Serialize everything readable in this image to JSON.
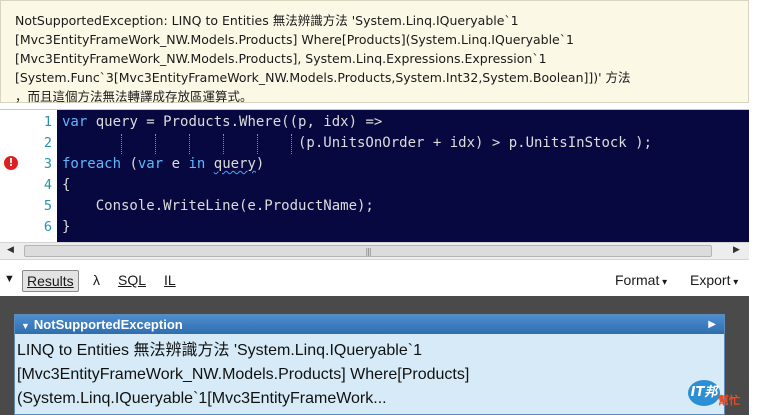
{
  "error_banner": {
    "lines": [
      "NotSupportedException: LINQ to Entities 無法辨識方法 'System.Linq.IQueryable`1",
      "[Mvc3EntityFrameWork_NW.Models.Products] Where[Products](System.Linq.IQueryable`1",
      "[Mvc3EntityFrameWork_NW.Models.Products], System.Linq.Expressions.Expression`1",
      "[System.Func`3[Mvc3EntityFrameWork_NW.Models.Products,System.Int32,System.Boolean]])' 方法",
      "，而且這個方法無法轉譯成存放區運算式。"
    ]
  },
  "editor": {
    "line_numbers": [
      "1",
      "2",
      "3",
      "4",
      "5",
      "6"
    ],
    "code": {
      "l1_kw": "var",
      "l1_rest": " query = Products.Where((p, idx) =>",
      "l2": "                            (p.UnitsOnOrder + idx) > p.UnitsInStock );",
      "l3_kw1": "foreach",
      "l3_mid": " (",
      "l3_kw2": "var",
      "l3_e": " e ",
      "l3_kw3": "in",
      "l3_sp": " ",
      "l3_query": "query",
      "l3_end": ")",
      "l4": "{",
      "l5": "    Console.WriteLine(e.ProductName);",
      "l6": "}"
    },
    "error_marker_icon": "error-circle-icon",
    "scroll_grip": "|||"
  },
  "toolbar": {
    "results": "Results",
    "lambda": "λ",
    "sql": "SQL",
    "il": "IL",
    "format": "Format",
    "export": "Export"
  },
  "results": {
    "header": "NotSupportedException",
    "body_lines": [
      "LINQ to Entities 無法辨識方法 'System.Linq.IQueryable`1",
      "[Mvc3EntityFrameWork_NW.Models.Products] Where[Products]",
      "(System.Linq.IQueryable`1[Mvc3EntityFrameWork..."
    ]
  },
  "watermark": {
    "text": "IT邦",
    "tag": "幫忙"
  },
  "colors": {
    "banner_bg": "#fbf8e6",
    "editor_bg": "#080840",
    "keyword": "#5fb7ff",
    "line_number": "#2b91af",
    "card_header": "#2f6eae",
    "card_bg": "#d6ebf7",
    "panel_bg": "#4a4a4a"
  }
}
